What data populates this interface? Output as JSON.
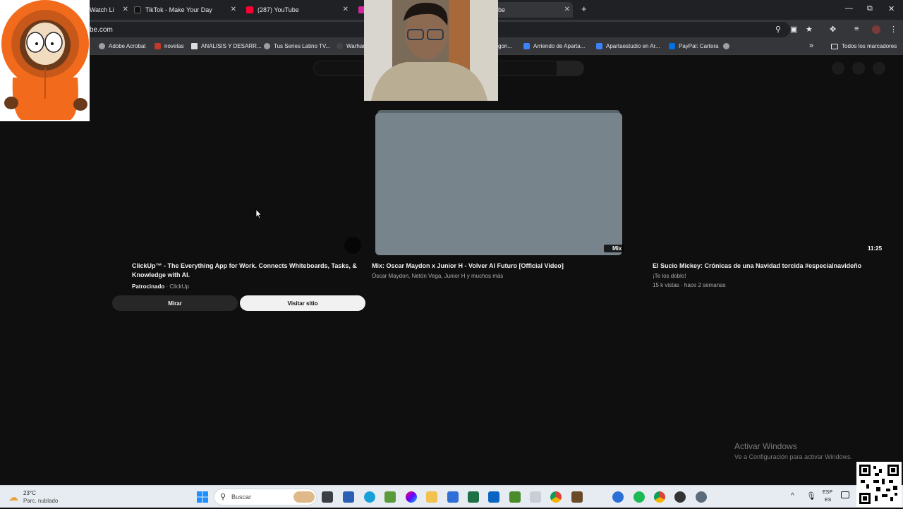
{
  "browser": {
    "tabs": [
      {
        "label": "Watch Li",
        "close": "✕"
      },
      {
        "label": "TikTok - Make Your Day",
        "close": "✕"
      },
      {
        "label": "(287) YouTube",
        "close": "✕"
      },
      {
        "label": "be",
        "close": "✕"
      }
    ],
    "new_tab": "+",
    "window": {
      "minimize": "—",
      "restore": "⧉",
      "close": "✕"
    },
    "url": "be.com",
    "bookmarks": [
      "Adobe Acrobat",
      "novelas",
      "ANALISIS Y DESARR...",
      "Tus Series Latino TV...",
      "Warhar",
      "gon...",
      "Arriendo de Aparta...",
      "Apartaestudio en Ar...",
      "PayPal: Cartera"
    ],
    "bookmarks_overflow": "»",
    "all_bookmarks": "Todos los marcadores"
  },
  "videos": {
    "ad": {
      "title_line1": "ClickUp™ - The Everything App for Work. Connects Whiteboards, Tasks, &",
      "title_line2": "Knowledge with AI.",
      "sponsored": "Patrocinado",
      "advertiser": " · ClickUp",
      "watch_label": "Mirar",
      "visit_label": "Visitar sitio"
    },
    "center": {
      "badge": "Mix",
      "title": "Mix: Oscar Maydon x Junior H - Volver Al Futuro [Official Video]",
      "meta": "Óscar Maydon, Netón Vega, Junior H y muchos más"
    },
    "right": {
      "duration": "11:25",
      "title": "El Sucio Mickey: Crónicas de una Navidad torcida #especialnavideño",
      "channel": "¡Te los doblo!",
      "meta": "15 k vistas · hace 2 semanas"
    }
  },
  "windows": {
    "activate_title": "Activar Windows",
    "activate_sub": "Ve a Configuración para activar Windows."
  },
  "taskbar": {
    "temperature": "23°C",
    "weather": "Parc. nublado",
    "search_placeholder": "Buscar",
    "lang_top": "ESP",
    "lang_bottom": "ES"
  }
}
